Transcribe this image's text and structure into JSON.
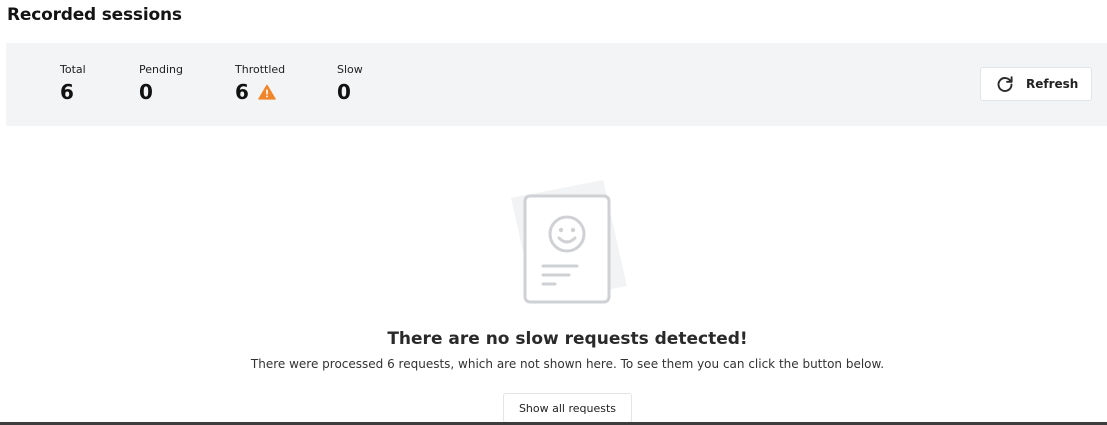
{
  "page": {
    "title": "Recorded sessions"
  },
  "stats": [
    {
      "label": "Total",
      "value": "6",
      "warning": false
    },
    {
      "label": "Pending",
      "value": "0",
      "warning": false
    },
    {
      "label": "Throttled",
      "value": "6",
      "warning": true
    },
    {
      "label": "Slow",
      "value": "0",
      "warning": false
    }
  ],
  "toolbar": {
    "refresh_label": "Refresh",
    "refresh_icon": "refresh-icon"
  },
  "empty_state": {
    "icon": "empty-document-smiley-icon",
    "title": "There are no slow requests detected!",
    "description": "There were processed 6 requests, which are not shown here. To see them you can click the button below.",
    "button_label": "Show all requests"
  },
  "colors": {
    "warning": "#f0862a",
    "panel_bg": "#f3f4f5",
    "illustration": "#cfd1d4"
  }
}
